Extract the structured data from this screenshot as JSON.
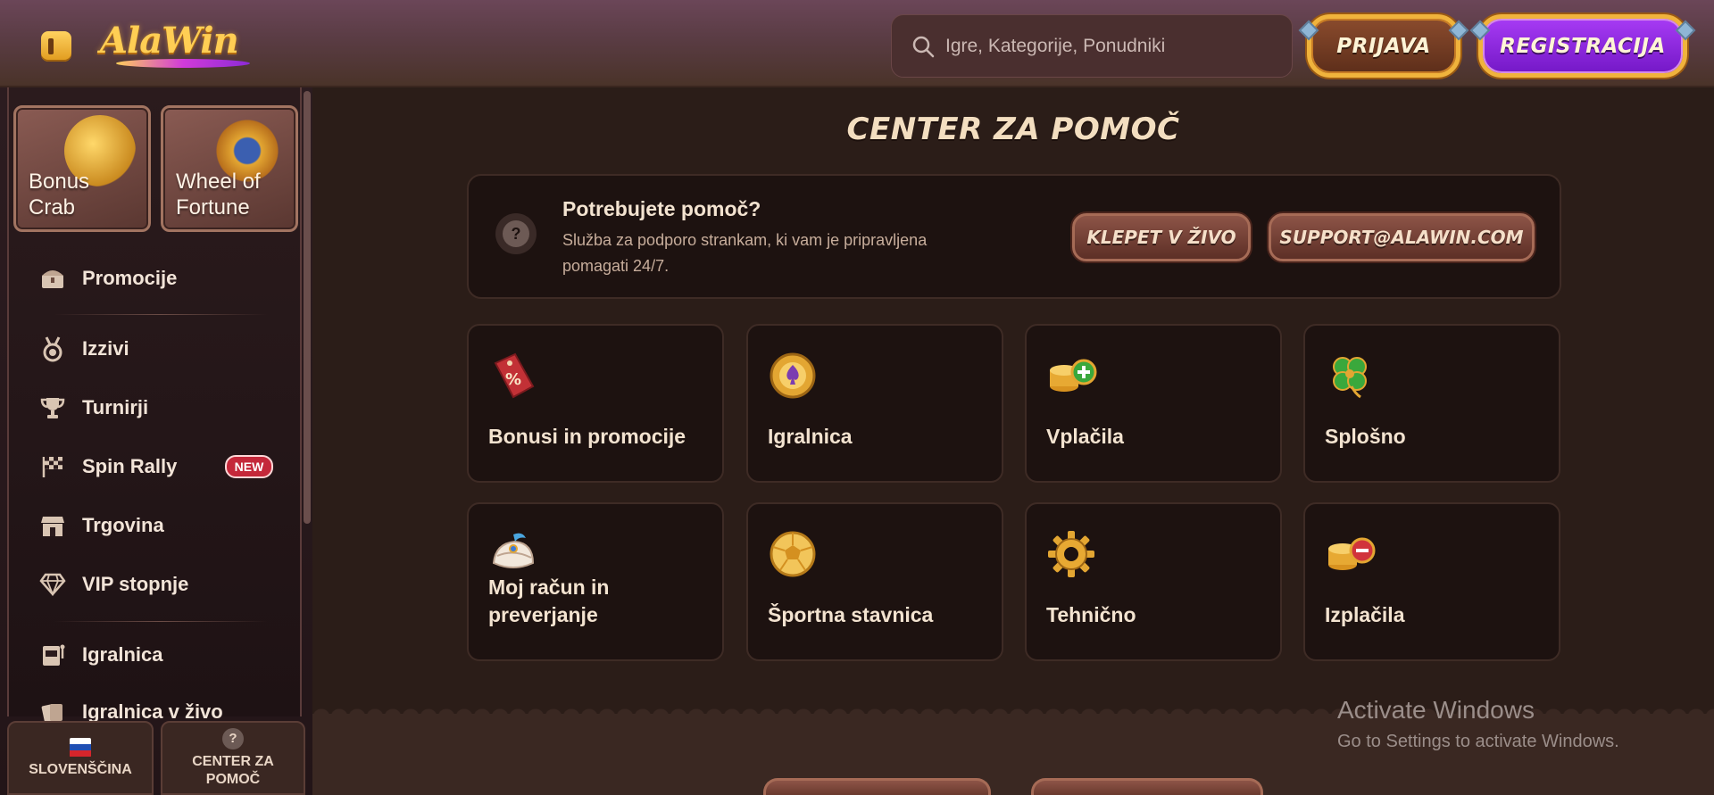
{
  "header": {
    "logo_text": "AlaWin",
    "search_placeholder": "Igre, Kategorije, Ponudniki",
    "login_label": "PRIJAVA",
    "register_label": "REGISTRACIJA"
  },
  "sidebar": {
    "promo_cards": [
      {
        "label_line1": "Bonus",
        "label_line2": "Crab"
      },
      {
        "label_line1": "Wheel of",
        "label_line2": "Fortune"
      }
    ],
    "items": [
      {
        "label": "Promocije",
        "icon": "treasure-chest-icon"
      },
      {
        "label": "Izzivi",
        "icon": "medal-icon"
      },
      {
        "label": "Turnirji",
        "icon": "trophy-icon"
      },
      {
        "label": "Spin Rally",
        "icon": "checkered-flag-icon",
        "badge": "NEW"
      },
      {
        "label": "Trgovina",
        "icon": "shop-icon"
      },
      {
        "label": "VIP stopnje",
        "icon": "diamond-icon"
      },
      {
        "label": "Igralnica",
        "icon": "slot-machine-icon"
      },
      {
        "label": "Igralnica v živo",
        "icon": "cards-icon"
      }
    ],
    "language_label": "SLOVENŠČINA",
    "help_center_line1": "CENTER ZA",
    "help_center_line2": "POMOČ"
  },
  "main": {
    "title": "CENTER ZA POMOČ",
    "help": {
      "title": "Potrebujete pomoč?",
      "desc_line1": "Služba za podporo strankam, ki vam je pripravljena",
      "desc_line2": "pomagati 24/7.",
      "chat_label": "KLEPET V ŽIVO",
      "email_label": "SUPPORT@ALAWIN.COM"
    },
    "categories": [
      {
        "label": "Bonusi in promocije",
        "icon": "percent-tag-icon"
      },
      {
        "label": "Igralnica",
        "icon": "spade-chip-icon"
      },
      {
        "label": "Vplačila",
        "icon": "coins-plus-icon"
      },
      {
        "label": "Splošno",
        "icon": "clover-icon"
      },
      {
        "label_line1": "Moj račun in",
        "label_line2": "preverjanje",
        "icon": "turban-icon"
      },
      {
        "label": "Športna stavnica",
        "icon": "football-icon"
      },
      {
        "label": "Tehnično",
        "icon": "gear-icon"
      },
      {
        "label": "Izplačila",
        "icon": "coins-minus-icon"
      }
    ]
  },
  "overlay": {
    "activate_title": "Activate Windows",
    "activate_sub": "Go to Settings to activate Windows."
  },
  "colors": {
    "accent_gold": "#f0b33c",
    "register_purple": "#8a26dd",
    "panel_bg": "#1d1210",
    "badge_red": "#c4283a"
  }
}
